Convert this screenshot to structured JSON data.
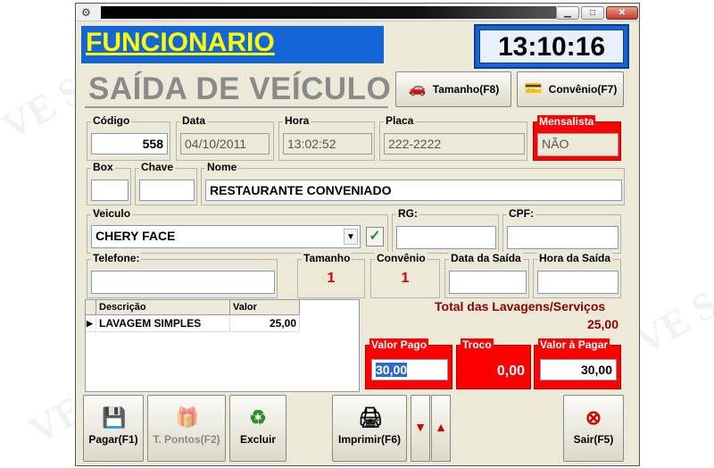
{
  "watermark": "VE Software",
  "header": {
    "title": "FUNCIONARIO",
    "clock": "13:10:16"
  },
  "subtitle": "SAÍDA DE VEÍCULO",
  "toolbar": {
    "tamanho_label": "Tamanho(F8)",
    "convenio_label": "Convênio(F7)"
  },
  "fields": {
    "codigo": {
      "label": "Código",
      "value": "558"
    },
    "data": {
      "label": "Data",
      "value": "04/10/2011"
    },
    "hora": {
      "label": "Hora",
      "value": "13:02:52"
    },
    "placa": {
      "label": "Placa",
      "value": "222-2222"
    },
    "mensalista": {
      "label": "Mensalista",
      "value": "NÃO"
    },
    "box": {
      "label": "Box",
      "value": ""
    },
    "chave": {
      "label": "Chave",
      "value": ""
    },
    "nome": {
      "label": "Nome",
      "value": "RESTAURANTE CONVENIADO"
    },
    "veiculo": {
      "label": "Veiculo",
      "value": "CHERY FACE"
    },
    "rg": {
      "label": "RG:",
      "value": ""
    },
    "cpf": {
      "label": "CPF:",
      "value": ""
    },
    "telefone": {
      "label": "Telefone:",
      "value": ""
    },
    "tamanho": {
      "label": "Tamanho",
      "value": "1"
    },
    "convenio": {
      "label": "Convênio",
      "value": "1"
    },
    "data_saida": {
      "label": "Data da Saída",
      "value": ""
    },
    "hora_saida": {
      "label": "Hora da Saída",
      "value": ""
    }
  },
  "grid": {
    "columns": [
      "Descrição",
      "Valor"
    ],
    "rows": [
      {
        "marker": "▶",
        "descricao": "LAVAGEM SIMPLES",
        "valor": "25,00"
      }
    ]
  },
  "totals": {
    "label": "Total das Lavagens/Serviços",
    "value": "25,00"
  },
  "payment": {
    "valor_pago": {
      "label": "Valor Pago",
      "value": "30,00"
    },
    "troco": {
      "label": "Troco",
      "value": "0,00"
    },
    "valor_pagar": {
      "label": "Valor à Pagar",
      "value": "30,00"
    }
  },
  "buttons": {
    "pagar": "Pagar(F1)",
    "pontos": "T. Pontos(F2)",
    "excluir": "Excluir",
    "imprimir": "Imprimir(F6)",
    "sair": "Sair(F5)"
  },
  "colors": {
    "title_blue": "#1565d8",
    "title_yellow": "#ffff00",
    "alert_red": "#ff0000",
    "total_red": "#8b0000"
  }
}
